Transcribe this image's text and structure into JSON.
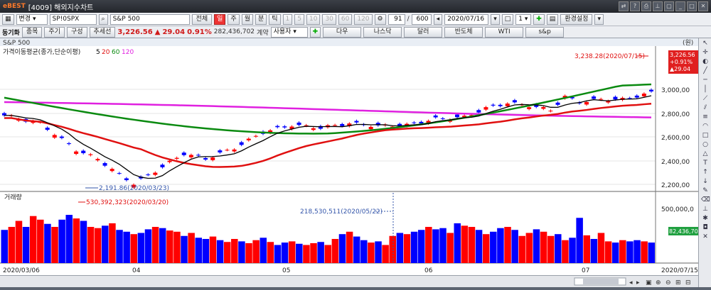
{
  "window": {
    "logo": "eBEST",
    "title": "[4009] 해외지수차트"
  },
  "toolbar": {
    "change_label": "변경",
    "symbol_code": "SP!0SPX",
    "symbol_name": "S&P 500",
    "all_label": "전체",
    "period_tabs": [
      "일",
      "주",
      "월",
      "분",
      "틱"
    ],
    "interval_buttons": [
      "1",
      "5",
      "10",
      "30",
      "60",
      "120"
    ],
    "count_value": "91",
    "count_total": "600",
    "date_value": "2020/07/16",
    "small_value": "1",
    "settings_label": "환경설정"
  },
  "toolbar2": {
    "group_label": "동기화",
    "item_label": "종목",
    "period_label": "주기",
    "layout_label": "구성",
    "add_series_label": "추세선",
    "price": "3,226.56",
    "change_arrow": "▲",
    "change": "29.04",
    "change_pct": "0.91%",
    "volume": "282,436,702",
    "contract_label": "계약",
    "user_label": "사용자",
    "quick_buttons": [
      "다우",
      "나스닥",
      "달러",
      "반도체",
      "WTI",
      "s&p"
    ]
  },
  "chart": {
    "symbol": "S&P 500",
    "price_panel_title": "가격이동평균(종가,단순이평)",
    "ma_periods": [
      "5",
      "20",
      "60",
      "120"
    ],
    "volume_panel_title": "거래량",
    "y_ticks": [
      "3,000,00",
      "2,800,00",
      "2,600,00",
      "2,400,00",
      "2,200,00"
    ],
    "vol_ticks": [
      "500,000,0"
    ],
    "unit_label": "(원)",
    "last_price_badge": "3,226.56",
    "last_change_pct_badge": "+0.91%",
    "last_change_badge": "▲29.04",
    "last_volume_badge": "82,436,70",
    "annot_high": "3,238.28(2020/07/15)",
    "annot_low": "2,191.86(2020/03/23)",
    "annot_vol_high": "530,392,323(2020/03/20)",
    "annot_vol_cursor": "218,530,511(2020/05/22)",
    "x_labels": [
      "2020/03/06",
      "04",
      "05",
      "06",
      "07",
      "2020/07/15"
    ],
    "colors": {
      "up": "#ff0000",
      "down": "#0000ff",
      "ma5": "#000000",
      "ma20": "#e01010",
      "ma60": "#0a8a10",
      "ma120": "#e020e0"
    }
  },
  "chart_data": {
    "type": "candlestick",
    "x": [
      "2020/03/06",
      "2020/07/15"
    ],
    "ylim": [
      2150,
      3300
    ],
    "high": {
      "value": 3238.28,
      "date": "2020/07/15"
    },
    "low": {
      "value": 2191.86,
      "date": "2020/03/23"
    },
    "volume_high": {
      "value": 530392323,
      "date": "2020/03/20"
    }
  }
}
